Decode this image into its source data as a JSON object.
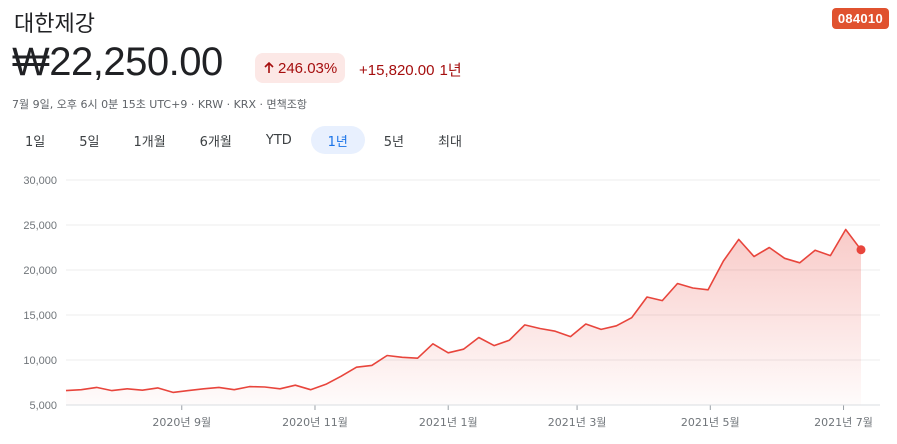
{
  "header": {
    "company": "대한제강",
    "ticker": "084010",
    "price": "₩22,250.00",
    "change_pct": "246.03%",
    "change_abs": "+15,820.00",
    "change_period": "1년",
    "meta": "7월 9일, 오후 6시 0분 15초 UTC+9 · KRW · KRX · 면책조항"
  },
  "ranges": [
    "1일",
    "5일",
    "1개월",
    "6개월",
    "YTD",
    "1년",
    "5년",
    "최대"
  ],
  "active_range": "1년",
  "colors": {
    "line": "#e8453c",
    "ticker_bg": "#e0522f",
    "pill_bg": "#fce8e6",
    "pill_text": "#a50e0e",
    "grid": "#ececec"
  },
  "chart_data": {
    "type": "area",
    "title": "",
    "xlabel": "",
    "ylabel": "",
    "ylim": [
      5000,
      30000
    ],
    "xlim": [
      "2020-07-10",
      "2021-07-09"
    ],
    "yticks": [
      "30,000",
      "25,000",
      "20,000",
      "15,000",
      "10,000",
      "5,000"
    ],
    "xticks": [
      {
        "label": "2020년 9월",
        "date": "2020-09-01"
      },
      {
        "label": "2020년 11월",
        "date": "2020-11-01"
      },
      {
        "label": "2021년 1월",
        "date": "2021-01-01"
      },
      {
        "label": "2021년 3월",
        "date": "2021-03-01"
      },
      {
        "label": "2021년 5월",
        "date": "2021-05-01"
      },
      {
        "label": "2021년 7월",
        "date": "2021-07-01"
      }
    ],
    "grid": true,
    "series": [
      {
        "x": [
          "2020-07-10",
          "2020-07-17",
          "2020-07-24",
          "2020-07-31",
          "2020-08-07",
          "2020-08-14",
          "2020-08-21",
          "2020-08-28",
          "2020-09-04",
          "2020-09-11",
          "2020-09-18",
          "2020-09-25",
          "2020-10-02",
          "2020-10-09",
          "2020-10-16",
          "2020-10-23",
          "2020-10-30",
          "2020-11-06",
          "2020-11-13",
          "2020-11-20",
          "2020-11-27",
          "2020-12-04",
          "2020-12-11",
          "2020-12-18",
          "2020-12-25",
          "2021-01-01",
          "2021-01-08",
          "2021-01-15",
          "2021-01-22",
          "2021-01-29",
          "2021-02-05",
          "2021-02-12",
          "2021-02-19",
          "2021-02-26",
          "2021-03-05",
          "2021-03-12",
          "2021-03-19",
          "2021-03-26",
          "2021-04-02",
          "2021-04-09",
          "2021-04-16",
          "2021-04-23",
          "2021-04-30",
          "2021-05-07",
          "2021-05-14",
          "2021-05-21",
          "2021-05-28",
          "2021-06-04",
          "2021-06-11",
          "2021-06-18",
          "2021-06-25",
          "2021-07-02",
          "2021-07-09"
        ],
        "values": [
          6600,
          6700,
          6950,
          6600,
          6800,
          6650,
          6900,
          6400,
          6600,
          6800,
          6950,
          6700,
          7050,
          7000,
          6800,
          7200,
          6700,
          7300,
          8200,
          9200,
          9400,
          10500,
          10300,
          10200,
          11800,
          10800,
          11200,
          12500,
          11600,
          12200,
          13900,
          13500,
          13200,
          12600,
          14000,
          13400,
          13800,
          14700,
          17000,
          16600,
          18500,
          18000,
          17800,
          21000,
          23400,
          21500,
          22500,
          21300,
          20800,
          22200,
          21600,
          24500,
          22250
        ]
      }
    ]
  }
}
